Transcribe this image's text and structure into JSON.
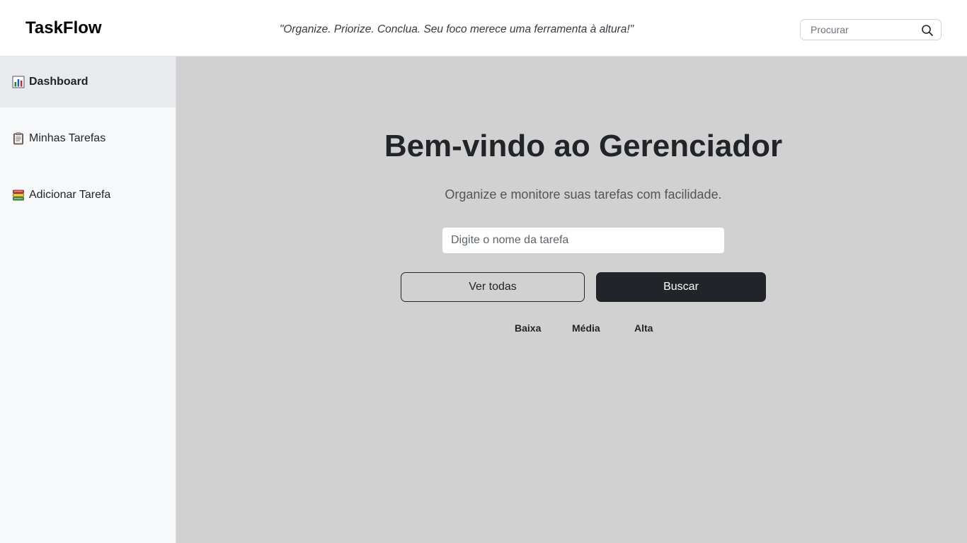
{
  "header": {
    "brand": "TaskFlow",
    "tagline": "\"Organize. Priorize. Conclua. Seu foco merece uma ferramenta à altura!\"",
    "search_placeholder": "Procurar",
    "search_icon": "search-icon"
  },
  "sidebar": {
    "items": [
      {
        "label": "Dashboard",
        "icon": "bar-chart-icon",
        "active": true
      },
      {
        "label": "Minhas Tarefas",
        "icon": "clipboard-icon",
        "active": false
      },
      {
        "label": "Adicionar Tarefa",
        "icon": "books-icon",
        "active": false
      }
    ]
  },
  "main": {
    "title": "Bem-vindo ao Gerenciador",
    "subtitle": "Organize e monitore suas tarefas com facilidade.",
    "task_input_placeholder": "Digite o nome da tarefa",
    "view_all_label": "Ver todas",
    "search_button_label": "Buscar",
    "priorities": [
      "Baixa",
      "Média",
      "Alta"
    ]
  },
  "colors": {
    "accent": "#0d6efd",
    "dark_button": "#212529",
    "main_background": "#d1d1d1",
    "sidebar_background": "#f7f8fa"
  }
}
